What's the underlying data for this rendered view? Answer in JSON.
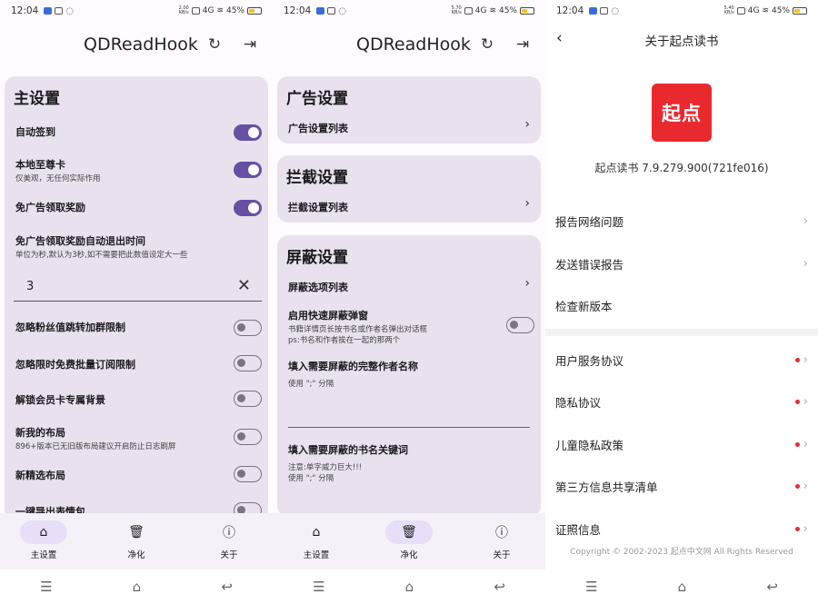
{
  "status": {
    "time": "12:04",
    "net_speed_1": "2.00 KB/s",
    "net_speed_2": "5.70 KB/s",
    "net_speed_3": "5.40 KB/s",
    "net": "4G",
    "battery": "45%"
  },
  "app": {
    "title": "QDReadHook",
    "refresh_icon": "refresh-icon",
    "exit_icon": "exit-icon"
  },
  "main": {
    "header": "主设置",
    "items": [
      {
        "label": "自动签到",
        "state": "on"
      },
      {
        "label": "本地至尊卡",
        "sub": "仅美观，无任何实际作用",
        "state": "on"
      },
      {
        "label": "免广告领取奖励",
        "state": "on"
      },
      {
        "label": "免广告领取奖励自动退出时间",
        "sub": "单位为秒,默认为3秒,如不需要把此数值设定大一些"
      },
      {
        "label": "忽略粉丝值跳转加群限制",
        "state": "off"
      },
      {
        "label": "忽略限时免费批量订阅限制",
        "state": "off"
      },
      {
        "label": "解锁会员卡专属背景",
        "state": "off"
      },
      {
        "label": "新我的布局",
        "sub": "896+版本已无旧版布局建议开启防止日志刷屏",
        "state": "off"
      },
      {
        "label": "新精选布局",
        "state": "off"
      },
      {
        "label": "一键导出表情包",
        "state": "off"
      }
    ],
    "timeout_value": "3"
  },
  "purify": {
    "ad_header": "广告设置",
    "ad_list": "广告设置列表",
    "intercept_header": "拦截设置",
    "intercept_list": "拦截设置列表",
    "block_header": "屏蔽设置",
    "block_list": "屏蔽选项列表",
    "quick_block_label": "启用快速屏蔽弹窗",
    "quick_block_sub1": "书籍详情页长按书名或作者名弹出对话框",
    "quick_block_sub2": "ps:书名和作者挨在一起的那两个",
    "author_label": "填入需要屏蔽的完整作者名称",
    "author_hint": "使用 \";\" 分隔",
    "keyword_label": "填入需要屏蔽的书名关键词",
    "keyword_hint1": "注意:单字威力巨大!!!",
    "keyword_hint2": "使用 \";\" 分隔"
  },
  "nav": {
    "main": "主设置",
    "purify": "净化",
    "about": "关于"
  },
  "about": {
    "title": "关于起点读书",
    "logo": "起点",
    "version": "起点读书 7.9.279.900(721fe016)",
    "menu1": [
      "报告网络问题",
      "发送错误报告",
      "检查新版本"
    ],
    "menu2": [
      "用户服务协议",
      "隐私协议",
      "儿童隐私政策",
      "第三方信息共享清单",
      "证照信息"
    ],
    "copyright": "Copyright © 2002-2023 起点中文网 All Rights Reserved"
  },
  "colors": {
    "accent": "#6750a4",
    "card": "#e9e1ee",
    "brand": "#e82a2f"
  }
}
